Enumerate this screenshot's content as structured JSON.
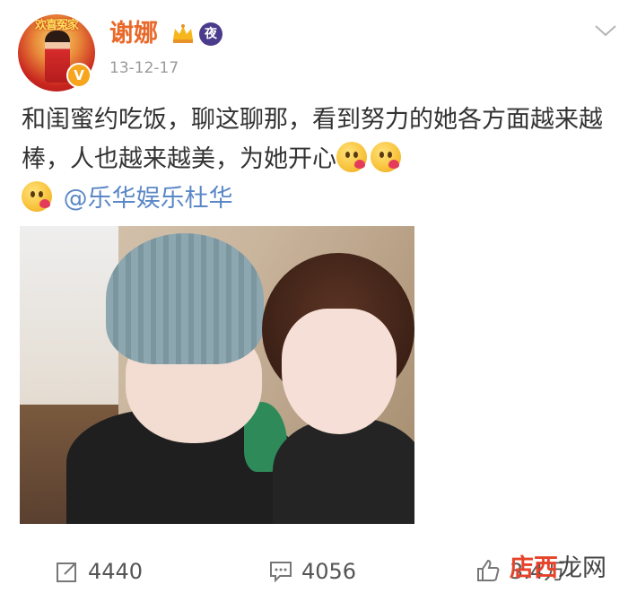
{
  "post": {
    "author": {
      "name": "谢娜",
      "avatar_caption": "欢喜冤家",
      "verified_icon": "V",
      "night_badge": "夜"
    },
    "timestamp": "13-12-17",
    "text_main": "和闺蜜约吃饭，聊这聊那，看到努力的她各方面越来越棒，人也越来越美，为她开心",
    "mention": "@乐华娱乐杜华",
    "emoji_names": [
      "kiss-face-emoji",
      "kiss-face-emoji",
      "kiss-face-emoji"
    ]
  },
  "actions": {
    "repost_count": "4440",
    "comment_count": "4056",
    "like_count": "3.4万"
  },
  "watermark": {
    "part_a": "店西",
    "part_b": "龙网"
  },
  "colors": {
    "username": "#e8692a",
    "mention": "#5b88c6",
    "timestamp": "#9a9a9a"
  }
}
